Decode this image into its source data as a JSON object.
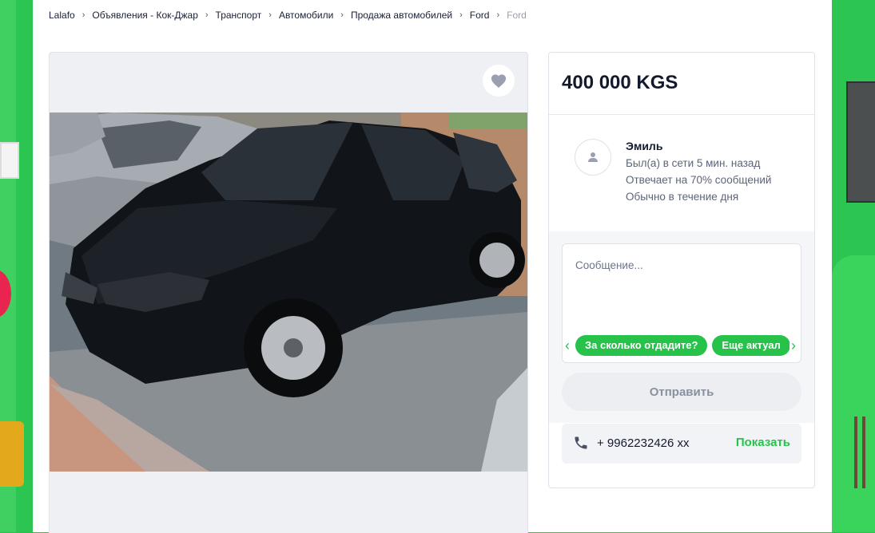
{
  "breadcrumb": {
    "items": [
      "Lalafo",
      "Объявления - Кок-Джар",
      "Транспорт",
      "Автомобили",
      "Продажа автомобилей",
      "Ford"
    ],
    "current": "Ford"
  },
  "listing": {
    "price": "400 000 KGS"
  },
  "seller": {
    "name": "Эмиль",
    "last_seen": "Был(а) в сети 5 мин. назад",
    "response_rate": "Отвечает на 70% сообщений",
    "response_time": "Обычно в течение дня"
  },
  "message": {
    "placeholder": "Сообщение...",
    "quick_replies": [
      "За сколько отдадите?",
      "Еще актуал"
    ],
    "send_label": "Отправить"
  },
  "phone": {
    "number": "+ 9962232426 xx",
    "show_label": "Показать"
  },
  "icons": {
    "favorite": "heart-icon",
    "avatar": "user-icon",
    "phone": "phone-icon",
    "chips_prev": "chevron-left-icon",
    "chips_next": "chevron-right-icon"
  },
  "colors": {
    "accent": "#26c24a",
    "ad_background": "#2dc552",
    "text_primary": "#131a2e"
  }
}
